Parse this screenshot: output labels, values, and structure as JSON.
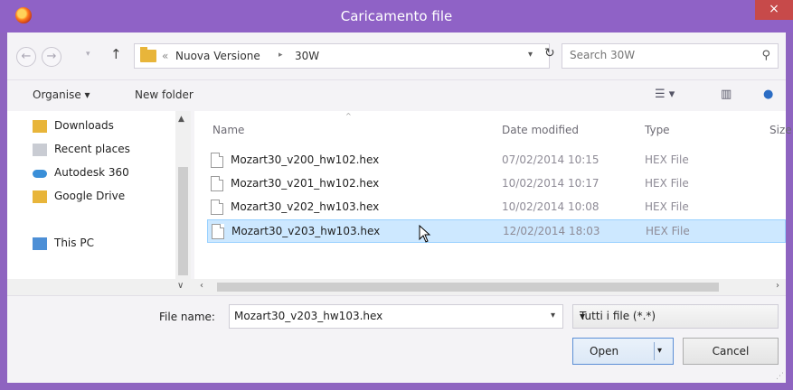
{
  "window": {
    "title": "Caricamento file",
    "close_label": "×"
  },
  "address": {
    "back_glyph": "←",
    "forward_glyph": "→",
    "breadcrumb_prefix": "«",
    "crumbs": [
      "Nuova Versione",
      "30W"
    ],
    "crumb_separator": "▸",
    "search_placeholder": "Search 30W"
  },
  "toolbar": {
    "organise_label": "Organise ▾",
    "new_folder_label": "New folder"
  },
  "nav": {
    "items": [
      {
        "label": "Downloads",
        "icon": "downloads-icon"
      },
      {
        "label": "Recent places",
        "icon": "recent-places-icon"
      },
      {
        "label": "Autodesk 360",
        "icon": "cloud-icon"
      },
      {
        "label": "Google Drive",
        "icon": "folder-icon"
      },
      {
        "label": "This PC",
        "icon": "computer-icon"
      }
    ]
  },
  "files": {
    "columns": {
      "name": "Name",
      "date": "Date modified",
      "type": "Type",
      "size": "Size"
    },
    "rows": [
      {
        "name": "Mozart30_v200_hw102.hex",
        "date": "07/02/2014 10:15",
        "type": "HEX File",
        "selected": false
      },
      {
        "name": "Mozart30_v201_hw102.hex",
        "date": "10/02/2014 10:17",
        "type": "HEX File",
        "selected": false
      },
      {
        "name": "Mozart30_v202_hw103.hex",
        "date": "10/02/2014 10:08",
        "type": "HEX File",
        "selected": false
      },
      {
        "name": "Mozart30_v203_hw103.hex",
        "date": "12/02/2014 18:03",
        "type": "HEX File",
        "selected": true
      }
    ]
  },
  "footer": {
    "filename_label": "File name:",
    "filename_value": "Mozart30_v203_hw103.hex",
    "filetype_value": "Tutti i file (*.*)",
    "open_label": "Open",
    "cancel_label": "Cancel"
  },
  "colors": {
    "titlebar": "#8f62c6",
    "selection": "#cde8ff",
    "close": "#c74a4a"
  }
}
